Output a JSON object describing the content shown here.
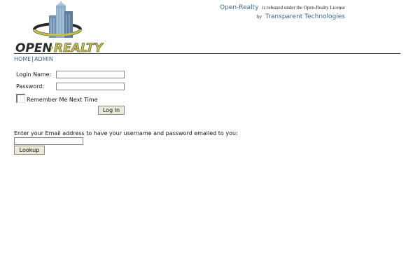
{
  "header": {
    "logo_text_open": "OPEN",
    "logo_text_realty": "REALTY",
    "license_brand": "Open-Realty",
    "license_text": "is released under the Open-Realty License",
    "license_by": "by",
    "license_company": "Transparent Technologies"
  },
  "nav": {
    "home": "HOME",
    "separator": "|",
    "admin": "ADMIN"
  },
  "login": {
    "login_name_label": "Login Name:",
    "login_name_value": "",
    "password_label": "Password:",
    "password_value": "",
    "remember_label": "Remember Me Next Time",
    "remember_checked": false,
    "submit_label": "Log In"
  },
  "lookup": {
    "prompt": "Enter your Email address to have your username and password emailed to you:",
    "email_value": "",
    "submit_label": "Lookup"
  },
  "colors": {
    "link": "#3a6a8f",
    "logo_dark": "#2a2a2a",
    "logo_gold": "#c8c040",
    "button_face": "#ece9d8"
  }
}
